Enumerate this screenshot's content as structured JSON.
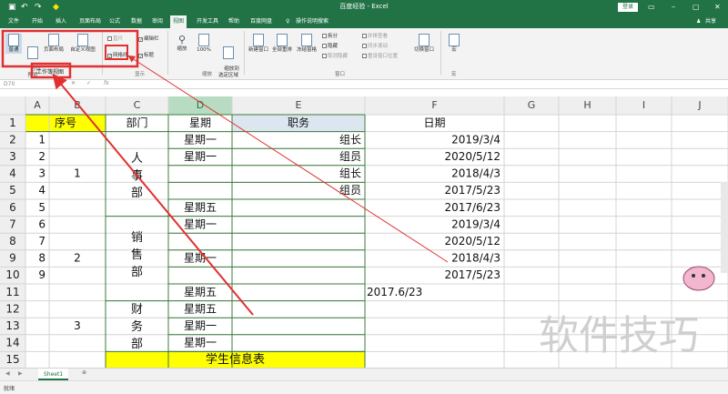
{
  "titlebar": {
    "doc_title": "百度经验 - Excel",
    "login": "登录",
    "qa_icons": [
      "save-icon",
      "undo-icon",
      "redo-icon",
      "fill-color-icon"
    ]
  },
  "menu": {
    "tabs": [
      "文件",
      "开始",
      "插入",
      "页面布局",
      "公式",
      "数据",
      "审阅",
      "视图",
      "开发工具",
      "帮助",
      "百度网盘"
    ],
    "tell_me": "操作说明搜索",
    "share": "共享",
    "active": "视图"
  },
  "ribbon": {
    "views": {
      "normal": "普通",
      "page_break": "分页\n预览",
      "page_layout": "页面布局",
      "custom": "自定义视图",
      "group": "工作簿视图"
    },
    "show": {
      "ruler": "直尺",
      "gridlines": "网格线",
      "formula_bar": "编辑栏",
      "headings": "标题",
      "group": "显示"
    },
    "zoom": {
      "zoom": "缩放",
      "zoom100": "100%",
      "zoom_sel": "缩放到\n选定区域",
      "group": "缩放"
    },
    "window": {
      "new_window": "新建窗口",
      "arrange_all": "全部重排",
      "freeze": "冻结窗格",
      "split": "拆分",
      "hide": "隐藏",
      "unhide": "取消隐藏",
      "side": "并排查看",
      "sync": "同步滚动",
      "reset": "重设窗口位置",
      "switch": "切换窗口",
      "group": "窗口"
    },
    "macros": {
      "label": "宏",
      "group": "宏"
    }
  },
  "formula": {
    "name_box": "D70",
    "fx": "fx"
  },
  "columns": [
    "A",
    "B",
    "C",
    "D",
    "E",
    "F",
    "G",
    "H",
    "I",
    "J"
  ],
  "rows": [
    "1",
    "2",
    "3",
    "4",
    "5",
    "6",
    "7",
    "8",
    "9",
    "10",
    "11",
    "12",
    "13",
    "14",
    "15"
  ],
  "table": {
    "headers": {
      "seq": "序号",
      "dept": "部门",
      "weekday": "星期",
      "role": "职务",
      "date": "日期"
    },
    "seq_numbers": [
      "1",
      "2",
      "3",
      "4",
      "5",
      "6",
      "7",
      "8",
      "9"
    ],
    "groups": [
      "1",
      "2",
      "3"
    ],
    "departments": [
      [
        "人",
        "事",
        "部"
      ],
      [
        "销",
        "售",
        "部"
      ],
      [
        "财",
        "务",
        "部"
      ]
    ],
    "weekdays": {
      "r2": "星期一",
      "r3": "星期一",
      "r6": "星期五",
      "r7": "星期一",
      "r9": "星期一",
      "r11": "星期五",
      "r12": "星期五",
      "r13": "星期一",
      "r14": "星期一"
    },
    "roles": {
      "r2": "组长",
      "r3": "组员",
      "r4": "组长",
      "r5": "组员"
    },
    "dates": {
      "r2": "2019/3/4",
      "r3": "2020/5/12",
      "r4": "2018/4/3",
      "r5": "2017/5/23",
      "r6": "2017/6/23",
      "r7": "2019/3/4",
      "r8": "2020/5/12",
      "r9": "2018/4/3",
      "r10": "2017/5/23"
    },
    "date_text_r11": "2017.6/23",
    "footer": "学生信息表"
  },
  "watermark": "软件技巧",
  "sheets": [
    "Sheet1"
  ],
  "status": {
    "ready": "就绪"
  },
  "colors": {
    "excel_green": "#217346",
    "header_yellow": "#ffff00",
    "role_header_fill": "#dce6f1",
    "highlight_red": "#e03030",
    "cell_border": "#3d7a3d"
  }
}
